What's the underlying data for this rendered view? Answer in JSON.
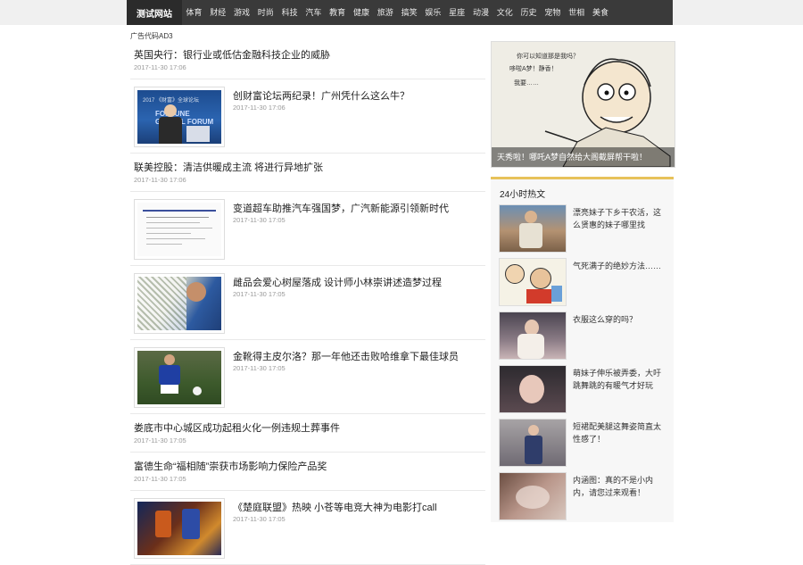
{
  "nav": {
    "logo": "测试网站",
    "items": [
      "体育",
      "财经",
      "游戏",
      "时尚",
      "科技",
      "汽车",
      "教育",
      "健康",
      "旅游",
      "搞笑",
      "娱乐",
      "星座",
      "动漫",
      "文化",
      "历史",
      "宠物",
      "世相",
      "美食"
    ]
  },
  "ad_label": "广告代码AD3",
  "feed": [
    {
      "title": "英国央行：银行业或低估金融科技企业的威胁",
      "date": "2017-11-30 17:06",
      "has_image": false
    },
    {
      "title": "创财富论坛两纪录！广州凭什么这么牛？",
      "date": "2017-11-30 17:06",
      "has_image": true,
      "icon": "forum-photo"
    },
    {
      "title": "联美控股：清洁供暖成主流 将进行异地扩张",
      "date": "2017-11-30 17:06",
      "has_image": false
    },
    {
      "title": "变道超车助推汽车强国梦，广汽新能源引领新时代",
      "date": "2017-11-30 17:05",
      "has_image": true,
      "icon": "document-photo"
    },
    {
      "title": "雌品会爱心树屋落成 设计师小林崇讲述造梦过程",
      "date": "2017-11-30 17:05",
      "has_image": true,
      "icon": "designer-photo"
    },
    {
      "title": "金靴得主皮尔洛？那一年他还击败哈维拿下最佳球员",
      "date": "2017-11-30 17:05",
      "has_image": true,
      "icon": "soccer-photo"
    },
    {
      "title": "娄底市中心城区成功起租火化一例违规土葬事件",
      "date": "2017-11-30 17:05",
      "has_image": false
    },
    {
      "title": "富德生命“福相随”崇获市场影响力保险产品奖",
      "date": "2017-11-30 17:05",
      "has_image": false
    },
    {
      "title": "《楚庭联盟》热映 小苍等电竞大神为电影打call",
      "date": "2017-11-30 17:05",
      "has_image": true,
      "icon": "game-poster"
    }
  ],
  "banner": {
    "caption": "天秀啦！哪吒A梦自然给大阁截屏帮干啦！",
    "icon": "cartoon-image"
  },
  "hot": {
    "heading": "24小时热文",
    "items": [
      {
        "title": "漂亮妹子下乡干农活，这么贤惠的妹子哪里找",
        "icon": "girl-photo"
      },
      {
        "title": "气死满子的绝妙方法……",
        "icon": "comic-image"
      },
      {
        "title": "衣服这么穿的吗？",
        "icon": "girl-photo"
      },
      {
        "title": "萌妹子伸乐被弄委，大吁跳舞跳的有暖气才好玩",
        "icon": "girl-photo"
      },
      {
        "title": "短裙配美腿这舞姿简直太性感了！",
        "icon": "girl-photo"
      },
      {
        "title": "内涵图：真的不是小内内，请您过来观看！",
        "icon": "fabric-photo"
      }
    ]
  },
  "colors": {
    "nav": "#3a3a3a",
    "accent": "#e7c25a"
  }
}
